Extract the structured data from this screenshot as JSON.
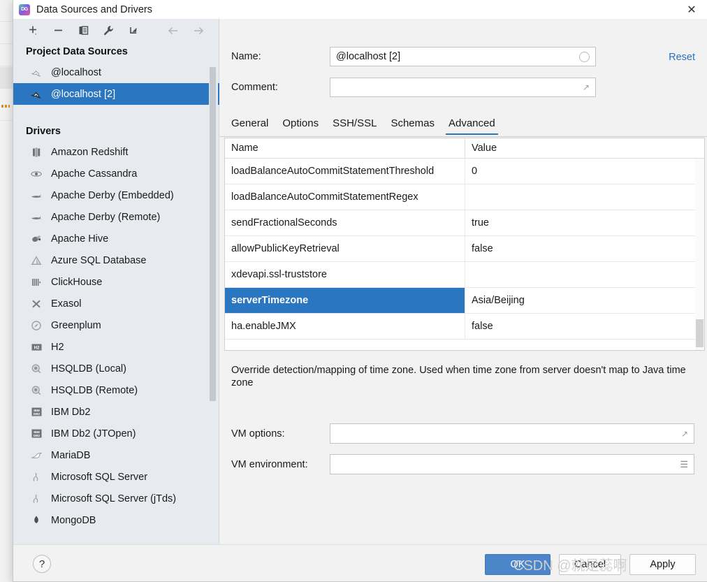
{
  "window": {
    "title": "Data Sources and Drivers",
    "app_icon": "datagrip-icon",
    "close_label": "✕"
  },
  "toolbar": {
    "items": [
      {
        "name": "add-data-source-button",
        "icon": "plus-icon",
        "label": "+"
      },
      {
        "name": "remove-data-source-button",
        "icon": "minus-icon",
        "label": "−"
      },
      {
        "name": "duplicate-button",
        "icon": "copy-icon",
        "label": "❐"
      },
      {
        "name": "properties-button",
        "icon": "wrench-icon",
        "label": "🔧"
      },
      {
        "name": "import-button",
        "icon": "import-arrow-icon",
        "label": "↙"
      },
      {
        "name": "back-button",
        "icon": "arrow-left-icon",
        "label": "←"
      },
      {
        "name": "forward-button",
        "icon": "arrow-right-icon",
        "label": "→"
      }
    ]
  },
  "sidebar": {
    "project_sources_title": "Project Data Sources",
    "data_sources": [
      {
        "label": "@localhost",
        "icon": "mysql-dolphin-icon",
        "selected": false
      },
      {
        "label": "@localhost [2]",
        "icon": "mysql-dolphin-icon",
        "selected": true
      }
    ],
    "drivers_title": "Drivers",
    "drivers": [
      {
        "label": "Amazon Redshift",
        "icon": "redshift-icon"
      },
      {
        "label": "Apache Cassandra",
        "icon": "cassandra-eye-icon"
      },
      {
        "label": "Apache Derby (Embedded)",
        "icon": "derby-icon"
      },
      {
        "label": "Apache Derby (Remote)",
        "icon": "derby-icon"
      },
      {
        "label": "Apache Hive",
        "icon": "hive-bee-icon"
      },
      {
        "label": "Azure SQL Database",
        "icon": "azure-triangle-icon"
      },
      {
        "label": "ClickHouse",
        "icon": "clickhouse-bars-icon"
      },
      {
        "label": "Exasol",
        "icon": "exasol-x-icon"
      },
      {
        "label": "Greenplum",
        "icon": "greenplum-circle-icon"
      },
      {
        "label": "H2",
        "icon": "h2-icon"
      },
      {
        "label": "HSQLDB (Local)",
        "icon": "hsqldb-icon"
      },
      {
        "label": "HSQLDB (Remote)",
        "icon": "hsqldb-icon"
      },
      {
        "label": "IBM Db2",
        "icon": "ibm-db2-icon"
      },
      {
        "label": "IBM Db2 (JTOpen)",
        "icon": "ibm-db2-icon"
      },
      {
        "label": "MariaDB",
        "icon": "mariadb-seal-icon"
      },
      {
        "label": "Microsoft SQL Server",
        "icon": "mssql-icon"
      },
      {
        "label": "Microsoft SQL Server (jTds)",
        "icon": "mssql-icon"
      },
      {
        "label": "MongoDB",
        "icon": "mongodb-leaf-icon"
      }
    ]
  },
  "form": {
    "name_label": "Name:",
    "name_value": "@localhost [2]",
    "comment_label": "Comment:",
    "comment_value": "",
    "reset_label": "Reset"
  },
  "tabs": [
    {
      "label": "General",
      "active": false
    },
    {
      "label": "Options",
      "active": false
    },
    {
      "label": "SSH/SSL",
      "active": false
    },
    {
      "label": "Schemas",
      "active": false
    },
    {
      "label": "Advanced",
      "active": true
    }
  ],
  "properties_table": {
    "columns": [
      "Name",
      "Value"
    ],
    "rows": [
      {
        "name": "loadBalanceAutoCommitStatementThreshold",
        "value": "0",
        "selected": false
      },
      {
        "name": "loadBalanceAutoCommitStatementRegex",
        "value": "",
        "selected": false
      },
      {
        "name": "sendFractionalSeconds",
        "value": "true",
        "selected": false
      },
      {
        "name": "allowPublicKeyRetrieval",
        "value": "false",
        "selected": false
      },
      {
        "name": "xdevapi.ssl-truststore",
        "value": "",
        "selected": false
      },
      {
        "name": "serverTimezone",
        "value": "Asia/Beijing",
        "selected": true
      },
      {
        "name": "ha.enableJMX",
        "value": "false",
        "selected": false
      }
    ]
  },
  "description": "Override detection/mapping of time zone. Used when time zone from server doesn't map to Java time zone",
  "vm": {
    "options_label": "VM options:",
    "options_value": "",
    "environment_label": "VM environment:",
    "environment_value": ""
  },
  "footer": {
    "help_label": "?",
    "ok_label": "OK",
    "cancel_label": "Cancel",
    "apply_label": "Apply"
  },
  "watermark": "CSDN @就是蕊啊",
  "colors": {
    "accent_blue": "#2a76c0",
    "ok_button": "#4a86c8",
    "link_blue": "#2a6fc0",
    "sidebar_bg": "#e7ebef",
    "dialog_bg": "#f2f2f2"
  }
}
